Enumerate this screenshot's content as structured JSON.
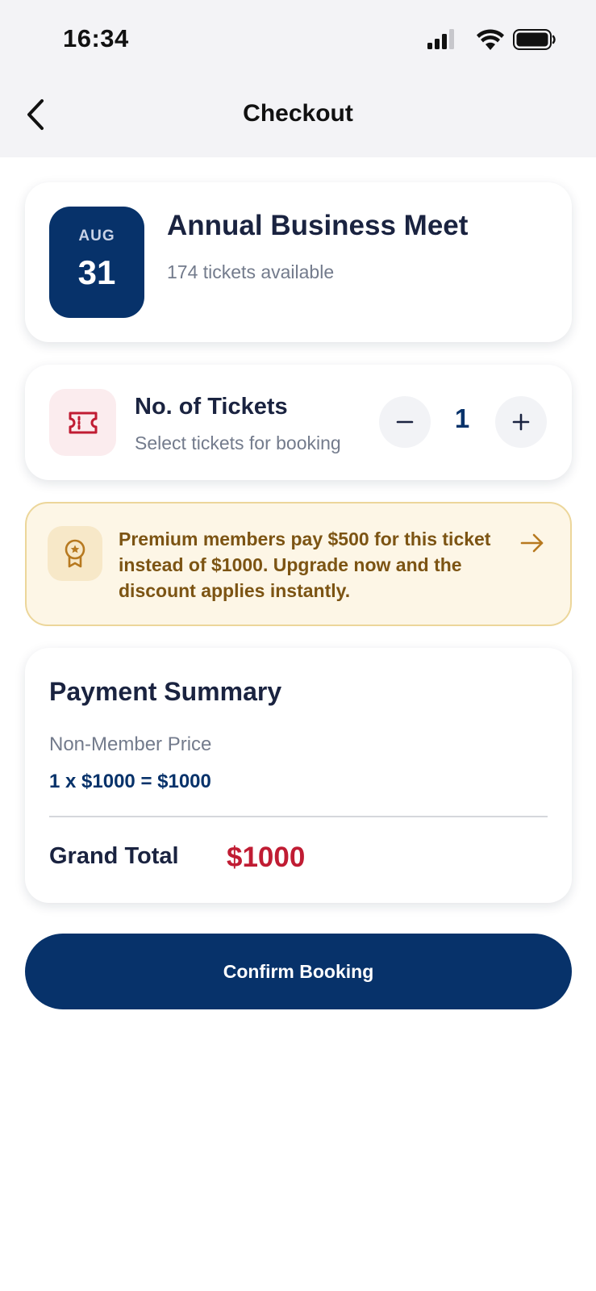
{
  "status_bar": {
    "time": "16:34"
  },
  "header": {
    "title": "Checkout",
    "back_icon": "chevron-left-icon"
  },
  "event": {
    "month": "AUG",
    "day": "31",
    "title": "Annual Business Meet",
    "availability": "174 tickets available"
  },
  "tickets": {
    "title": "No. of Tickets",
    "subtitle": "Select tickets for booking",
    "quantity": "1",
    "icon": "ticket-icon"
  },
  "promo": {
    "text": "Premium members pay $500 for this ticket instead of $1000. Upgrade now and the discount applies instantly.",
    "icon": "award-icon",
    "arrow_icon": "arrow-right-icon"
  },
  "payment": {
    "title": "Payment Summary",
    "price_label": "Non-Member Price",
    "calculation": "1 x $1000 = $1000",
    "grand_total_label": "Grand Total",
    "grand_total_value": "$1000"
  },
  "confirm_button": {
    "label": "Confirm Booking"
  },
  "colors": {
    "primary": "#07326a",
    "accent_red": "#c01c33",
    "promo_bg": "#fdf6e6",
    "promo_text": "#7c5413"
  }
}
